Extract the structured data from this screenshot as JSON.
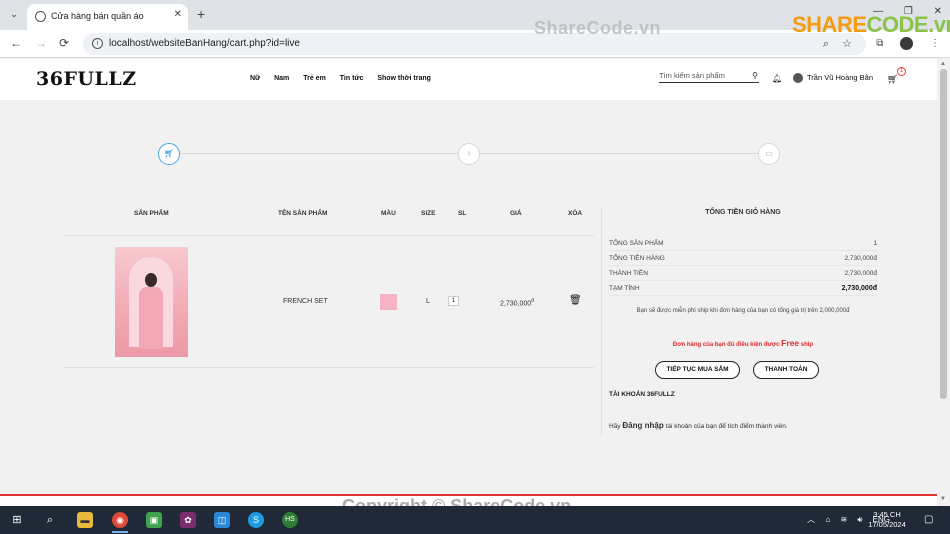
{
  "browser": {
    "tab_title": "Cửa hàng bán quần áo",
    "tab_close": "✕",
    "new_tab": "+",
    "url": "localhost/websiteBanHang/cart.php?id=live",
    "back": "←",
    "forward": "→",
    "reload": "⟳"
  },
  "site": {
    "logo": "36FULLZ",
    "nav": [
      "Nữ",
      "Nam",
      "Trẻ em",
      "Tin tức",
      "Show thời trang"
    ],
    "search_placeholder": "Tìm kiếm sản phẩm",
    "user_name": "Trần Vũ Hoàng Bân",
    "cart_count": "1"
  },
  "cart": {
    "headers": {
      "product": "SẢN PHẨM",
      "name": "TÊN SẢN PHẨM",
      "color": "MÀU",
      "size": "SIZE",
      "qty": "SL",
      "price": "GIÁ",
      "delete": "XÓA"
    },
    "items": [
      {
        "name": "FRENCH SET",
        "color_hex": "#f4b4c4",
        "size": "L",
        "qty": "1",
        "price": "2,730,000",
        "currency": "đ"
      }
    ]
  },
  "summary": {
    "title": "TỔNG TIỀN GIỎ HÀNG",
    "rows": [
      {
        "label": "TỔNG SẢN PHẨM",
        "value": "1"
      },
      {
        "label": "TỔNG TIỀN HÀNG",
        "value": "2,730,000đ"
      },
      {
        "label": "THÀNH TIỀN",
        "value": "2,730,000đ"
      },
      {
        "label": "TẠM TÍNH",
        "value": "2,730,000đ"
      }
    ],
    "free_ship_note": "Bạn sẽ được miễn phí ship khi đơn hàng của bạn có tổng giá trị trên 2,000,000đ",
    "free_ok_prefix": "Đơn hàng của bạn đủ điều kiện được",
    "free_ok_word": "Free",
    "free_ok_suffix": "ship",
    "continue_button": "TIẾP TỤC MUA SẮM",
    "checkout_button": "THANH TOÁN",
    "account_title": "TÀI KHOẢN 36FULLZ",
    "account_prefix": "Hãy",
    "account_link": "Đăng nhập",
    "account_suffix": "tài khoản của bạn để tích điểm thành viên."
  },
  "watermarks": {
    "top": "ShareCode.vn",
    "logo_share": "SHARE",
    "logo_code": "CODE.vn",
    "bottom": "Copyright © ShareCode.vn"
  },
  "taskbar": {
    "lang": "ENG",
    "time": "3:45 CH",
    "date": "17/05/2024"
  },
  "colors": {
    "accent_step": "#4aa7e2",
    "footer_red": "#dd3333",
    "free_red": "#e12b2b"
  }
}
